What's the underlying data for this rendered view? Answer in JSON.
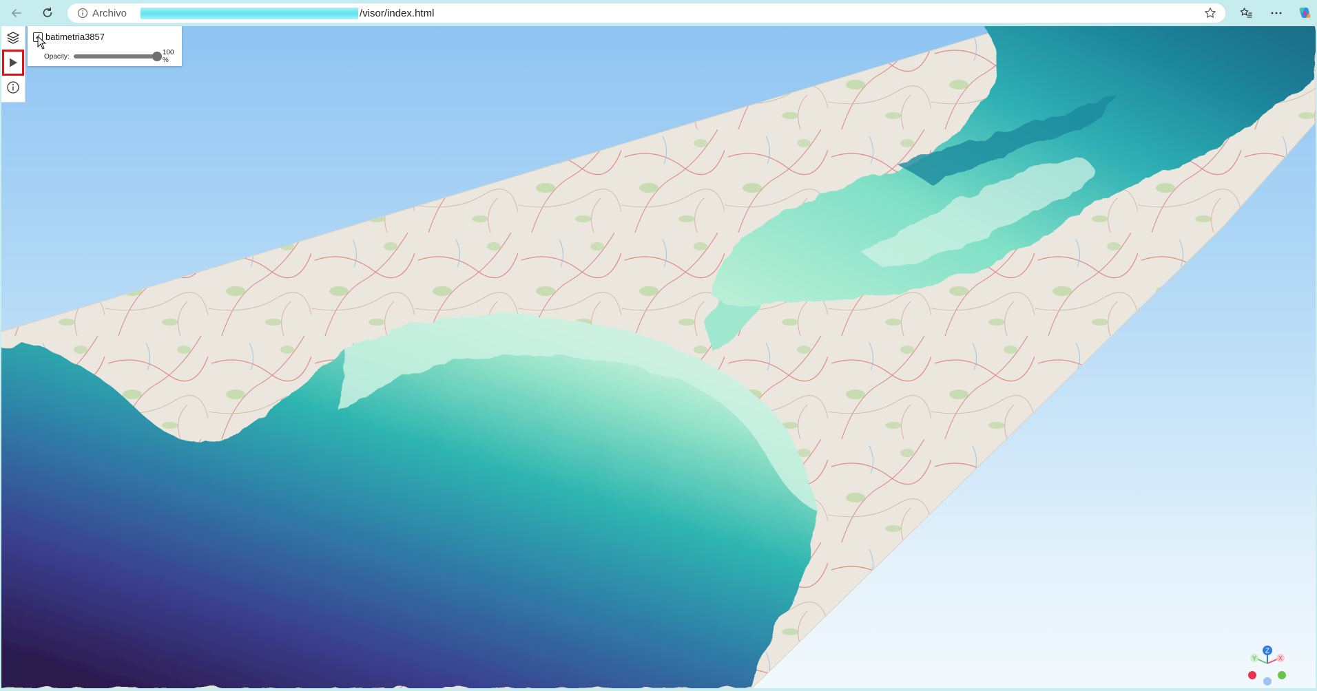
{
  "browser": {
    "address_label": "Archivo",
    "url": "/visor/index.html"
  },
  "layers": [
    {
      "name": "batimetria3857",
      "checked": true,
      "opacity_label": "Opacity:",
      "opacity": 1.0,
      "opacity_text": "100 %"
    }
  ],
  "toolbar": {
    "tools": [
      "layers-icon",
      "play-icon",
      "info-icon"
    ],
    "active": "play-icon"
  },
  "gizmo": {
    "labels": [
      "Y",
      "Z",
      "X"
    ]
  }
}
